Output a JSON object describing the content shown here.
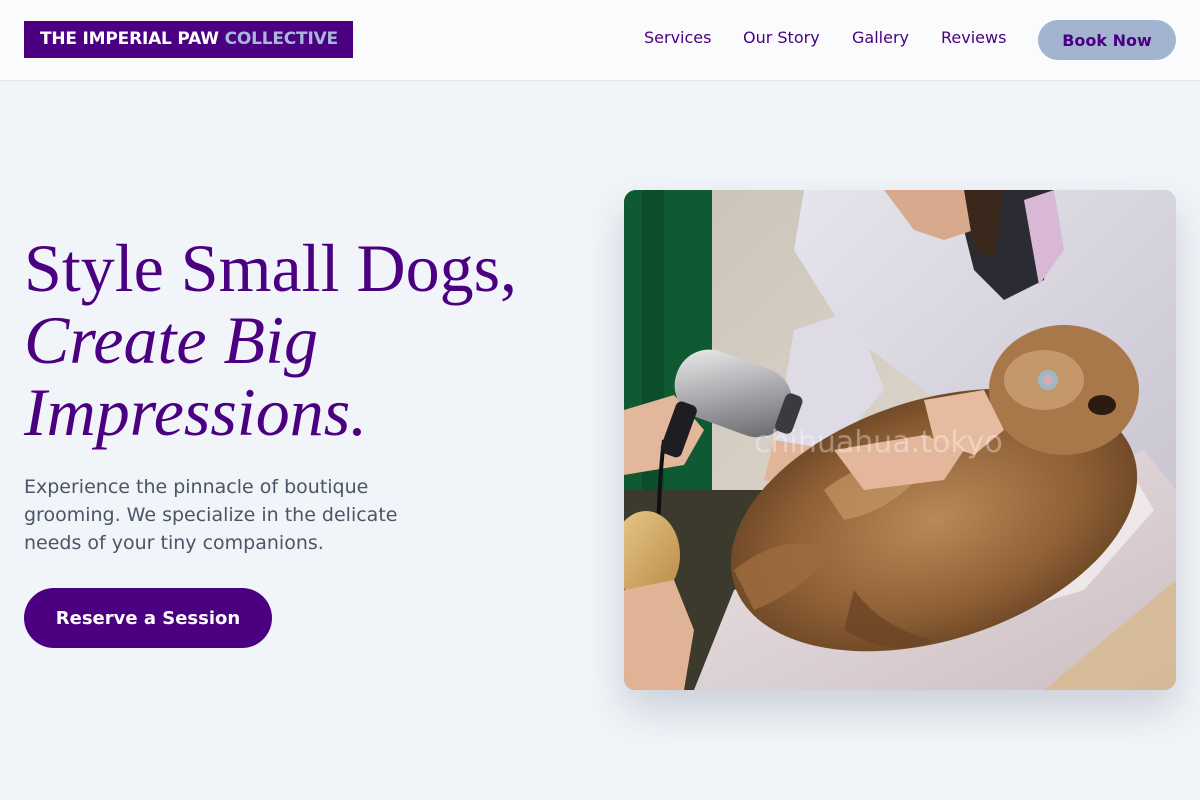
{
  "brand": {
    "name_main": "THE IMPERIAL PAW",
    "name_accent": "COLLECTIVE"
  },
  "nav": {
    "links": [
      {
        "label": "Services"
      },
      {
        "label": "Our Story"
      },
      {
        "label": "Gallery"
      },
      {
        "label": "Reviews"
      }
    ],
    "cta_label": "Book Now"
  },
  "hero": {
    "headline_line1": "Style Small Dogs,",
    "headline_line2": "Create Big",
    "headline_line3": "Impressions.",
    "subtext": "Experience the pinnacle of boutique grooming. We specialize in the delicate needs of your tiny companions.",
    "cta_label": "Reserve a Session",
    "photo_watermark": "chihuahua.tokyo"
  },
  "colors": {
    "brand_purple": "#4b0082",
    "nav_button_bg": "#a3b4d1",
    "page_bg": "#f1f4f8",
    "body_text": "#4a5568"
  },
  "icons": {
    "photo": "groomer-drying-dog-photo"
  }
}
